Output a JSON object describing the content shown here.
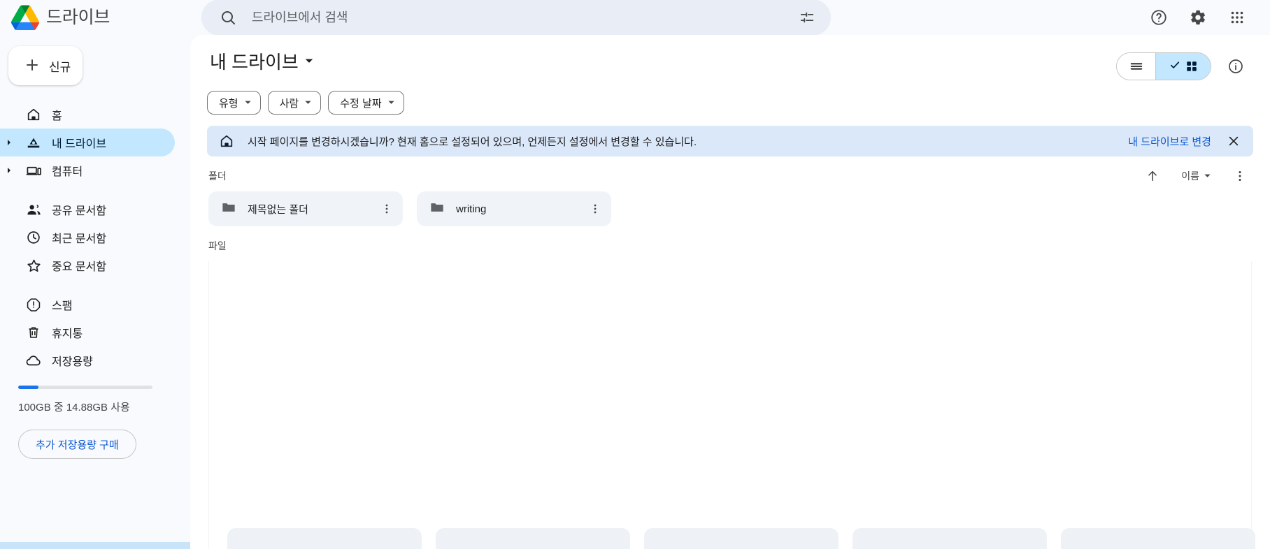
{
  "header": {
    "brand_name": "드라이브",
    "logo_icon": "google-drive-logo",
    "search": {
      "icon": "search-icon",
      "placeholder": "드라이브에서 검색",
      "value": "",
      "tune_icon": "tune-icon"
    },
    "actions": [
      {
        "name": "help-icon",
        "label": "지원"
      },
      {
        "name": "gear-icon",
        "label": "설정"
      },
      {
        "name": "apps-grid-icon",
        "label": "Google 앱"
      }
    ]
  },
  "sidebar": {
    "new_button": {
      "label": "신규",
      "icon": "plus-icon"
    },
    "items": [
      {
        "label": "홈",
        "icon": "home-icon",
        "active": false,
        "twisty": false
      },
      {
        "label": "내 드라이브",
        "icon": "my-drive-icon",
        "active": true,
        "twisty": true
      },
      {
        "label": "컴퓨터",
        "icon": "computer-icon",
        "active": false,
        "twisty": true
      },
      {
        "label": "공유 문서함",
        "icon": "people-icon",
        "active": false,
        "twisty": false
      },
      {
        "label": "최근 문서함",
        "icon": "clock-icon",
        "active": false,
        "twisty": false
      },
      {
        "label": "중요 문서함",
        "icon": "star-icon",
        "active": false,
        "twisty": false
      },
      {
        "label": "스팸",
        "icon": "spam-icon",
        "active": false,
        "twisty": false
      },
      {
        "label": "휴지통",
        "icon": "trash-icon",
        "active": false,
        "twisty": false
      },
      {
        "label": "저장용량",
        "icon": "cloud-icon",
        "active": false,
        "twisty": false
      }
    ],
    "storage": {
      "used_percent": 14.88,
      "text": "100GB 중 14.88GB 사용",
      "buy_label": "추가 저장용량 구매"
    }
  },
  "main": {
    "page_title": "내 드라이브",
    "title_caret_icon": "caret-down-icon",
    "view_toggle": {
      "list_icon": "list-view-icon",
      "grid_icon": "grid-view-icon",
      "check_icon": "check-icon",
      "selected": "grid"
    },
    "info_icon": "info-icon",
    "filters": [
      {
        "label": "유형",
        "caret": "caret-down-icon"
      },
      {
        "label": "사람",
        "caret": "caret-down-icon"
      },
      {
        "label": "수정 날짜",
        "caret": "caret-down-icon"
      }
    ],
    "banner": {
      "icon": "home-icon",
      "text": "시작 페이지를 변경하시겠습니까? 현재 홈으로 설정되어 있으며, 언제든지 설정에서 변경할 수 있습니다.",
      "link_label": "내 드라이브로 변경",
      "close_icon": "close-icon"
    },
    "folders_section": {
      "title": "폴더",
      "sort_up_icon": "arrow-up-icon",
      "sort_label": "이름",
      "sort_caret_icon": "caret-down-icon",
      "more_icon": "kebab-menu-icon",
      "items": [
        {
          "name": "제목없는 폴더",
          "icon": "folder-icon",
          "menu_icon": "kebab-menu-icon"
        },
        {
          "name": "writing",
          "icon": "folder-icon",
          "menu_icon": "kebab-menu-icon"
        }
      ]
    },
    "files_section": {
      "title": "파일",
      "items": [],
      "skeleton_count": 5
    }
  },
  "colors": {
    "accent_blue": "#0b57d0",
    "selected_nav": "#c2e7ff",
    "banner_bg": "#dbe8f9",
    "surface": "#f8fafd",
    "card": "#f0f4f9"
  }
}
